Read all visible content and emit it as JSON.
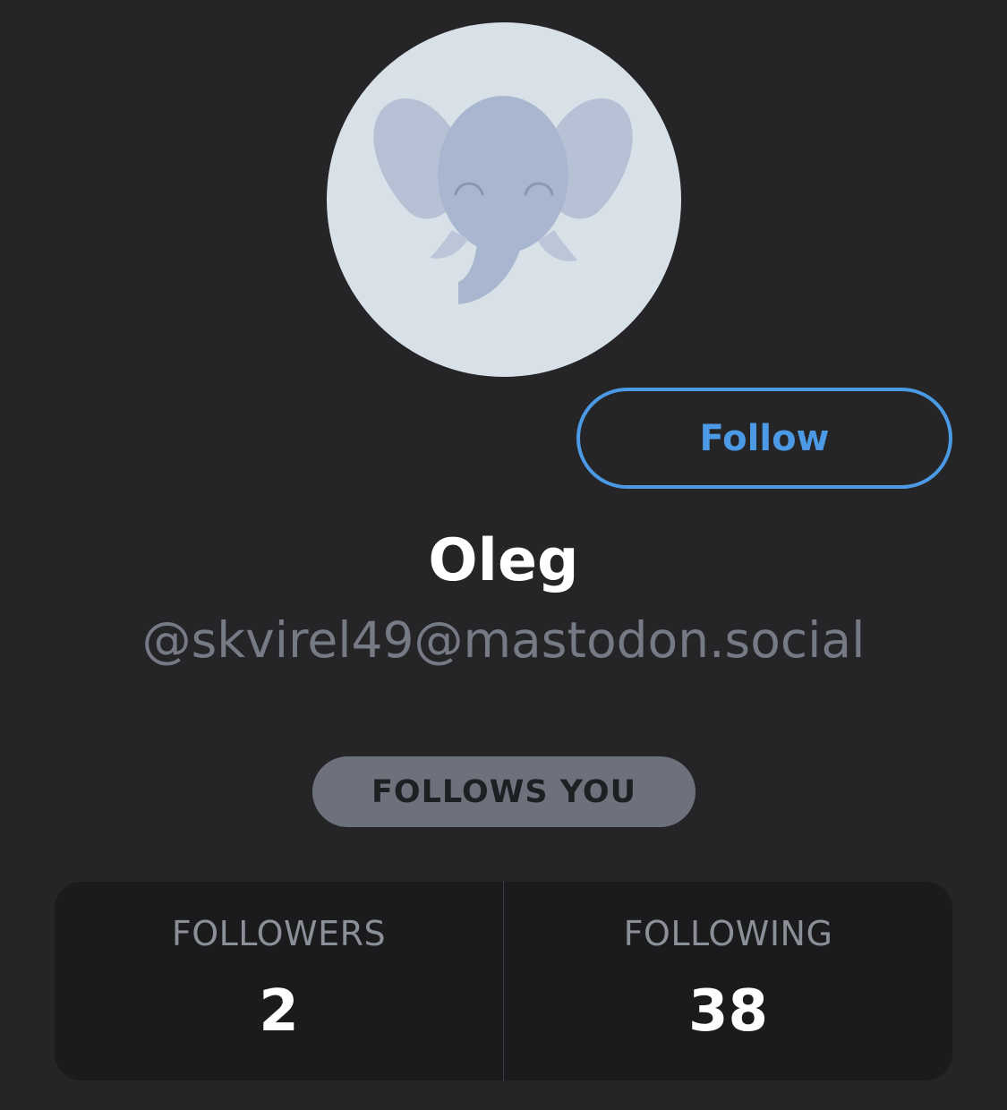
{
  "profile": {
    "display_name": "Oleg",
    "handle": "@skvirel49@mastodon.social",
    "follow_label": "Follow",
    "follows_you_label": "FOLLOWS YOU"
  },
  "stats": {
    "followers_label": "FOLLOWERS",
    "followers_count": "2",
    "following_label": "FOLLOWING",
    "following_count": "38"
  },
  "icons": {
    "avatar": "mastodon-elephant-default-avatar"
  },
  "colors": {
    "background": "#252528",
    "accent": "#4c9ae5",
    "badge": "#6c717b",
    "stats_panel": "#1b1b1d",
    "avatar_bg": "#d9e1e8",
    "elephant": "#a8b6cf"
  }
}
